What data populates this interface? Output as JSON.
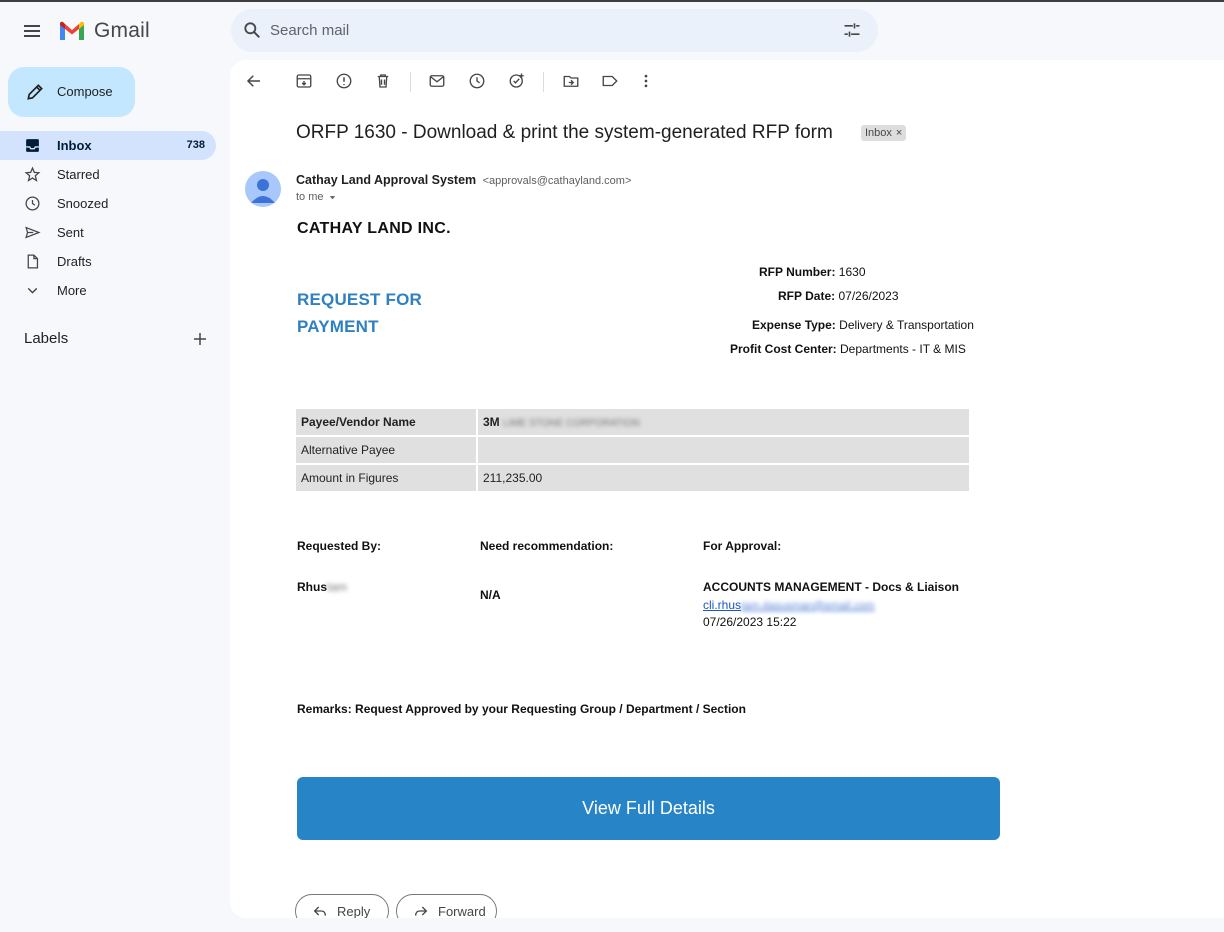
{
  "app": {
    "name": "Gmail"
  },
  "search": {
    "placeholder": "Search mail"
  },
  "compose": {
    "label": "Compose"
  },
  "sidebar": {
    "items": [
      {
        "label": "Inbox",
        "count": "738"
      },
      {
        "label": "Starred"
      },
      {
        "label": "Snoozed"
      },
      {
        "label": "Sent"
      },
      {
        "label": "Drafts"
      },
      {
        "label": "More"
      }
    ],
    "labels_header": "Labels"
  },
  "email": {
    "subject": "ORFP 1630 - Download & print the system-generated RFP form",
    "label_chip": "Inbox",
    "sender_name": "Cathay Land Approval System",
    "sender_email": "<approvals@cathayland.com>",
    "to": "to me",
    "company": "CATHAY LAND INC.",
    "title_line1": "REQUEST FOR",
    "title_line2": "PAYMENT",
    "rfp_number_label": "RFP Number:",
    "rfp_number": "1630",
    "rfp_date_label": "RFP Date:",
    "rfp_date": "07/26/2023",
    "expense_type_label": "Expense Type:",
    "expense_type": "Delivery & Transportation",
    "profit_center_label": "Profit Cost Center:",
    "profit_center": "Departments - IT & MIS",
    "table": [
      {
        "label": "Payee/Vendor Name",
        "value_visible": "3M",
        "value_blurred": "LIME STONE CORPORATION"
      },
      {
        "label": "Alternative Payee",
        "value_visible": ""
      },
      {
        "label": "Amount in Figures",
        "value_visible": "211,235.00"
      }
    ],
    "requested_by_label": "Requested By:",
    "need_recommendation_label": "Need recommendation:",
    "for_approval_label": "For Approval:",
    "requested_by_visible": "Rhus",
    "requested_by_blurred": "tam",
    "need_recommendation_value": "N/A",
    "approval_dept": "ACCOUNTS MANAGEMENT - Docs & Liaison",
    "approval_email_visible": "cli.rhus",
    "approval_email_blurred": "tam.dasusman@email.com",
    "approval_datetime": "07/26/2023 15:22",
    "remarks": "Remarks: Request Approved by your Requesting Group / Department / Section",
    "cta_label": "View Full Details"
  },
  "actions": {
    "reply": "Reply",
    "forward": "Forward"
  },
  "colors": {
    "accent": "#2784c6",
    "title_blue": "#2f80c1",
    "selected_nav": "#d3e3fd",
    "compose_bg": "#c2e7ff"
  }
}
